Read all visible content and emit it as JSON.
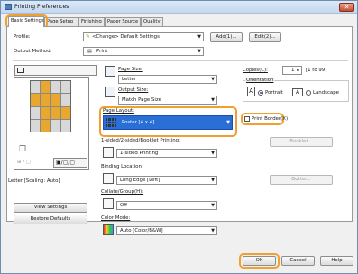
{
  "window": {
    "title": "Printing Preferences",
    "close_glyph": "✕"
  },
  "tabs": [
    {
      "label": "Basic Settings"
    },
    {
      "label": "Page Setup"
    },
    {
      "label": "Finishing"
    },
    {
      "label": "Paper Source"
    },
    {
      "label": "Quality"
    }
  ],
  "profile": {
    "label": "Profile:",
    "value": "<Change> Default Settings",
    "add_label": "Add(1)...",
    "edit_label": "Edit(2)..."
  },
  "output_method": {
    "label": "Output Method:",
    "value": "Print"
  },
  "page_size": {
    "label": "Page Size:",
    "value": "Letter"
  },
  "output_size": {
    "label": "Output Size:",
    "value": "Match Page Size"
  },
  "copies": {
    "label": "Copies(C):",
    "value": "1",
    "range": "[1 to 99]"
  },
  "orientation": {
    "label": "Orientation",
    "portrait": "Portrait",
    "landscape": "Landscape",
    "selected": "Portrait"
  },
  "page_layout": {
    "label": "Page Layout:",
    "value": "Poster [4 x 4]",
    "print_border_label": "Print Border(X)"
  },
  "sided": {
    "label": "1-sided/2-sided/Booklet Printing:",
    "value": "1-sided Printing",
    "booklet_label": "Booklet..."
  },
  "binding": {
    "label": "Binding Location:",
    "value": "Long Edge [Left]",
    "gutter_label": "Gutter..."
  },
  "collate": {
    "label": "Collate/Group(H):",
    "value": "Off"
  },
  "color_mode": {
    "label": "Color Mode:",
    "value": "Auto [Color/B&W]"
  },
  "preview": {
    "caption": "Letter [Scaling: Auto]",
    "view_settings": "View Settings",
    "restore_defaults": "Restore Defaults"
  },
  "footer": {
    "ok": "OK",
    "cancel": "Cancel",
    "help": "Help"
  },
  "colors": {
    "highlight": "#f0a030",
    "selection": "#2a6fd6",
    "accent": "#1a4fb0"
  }
}
